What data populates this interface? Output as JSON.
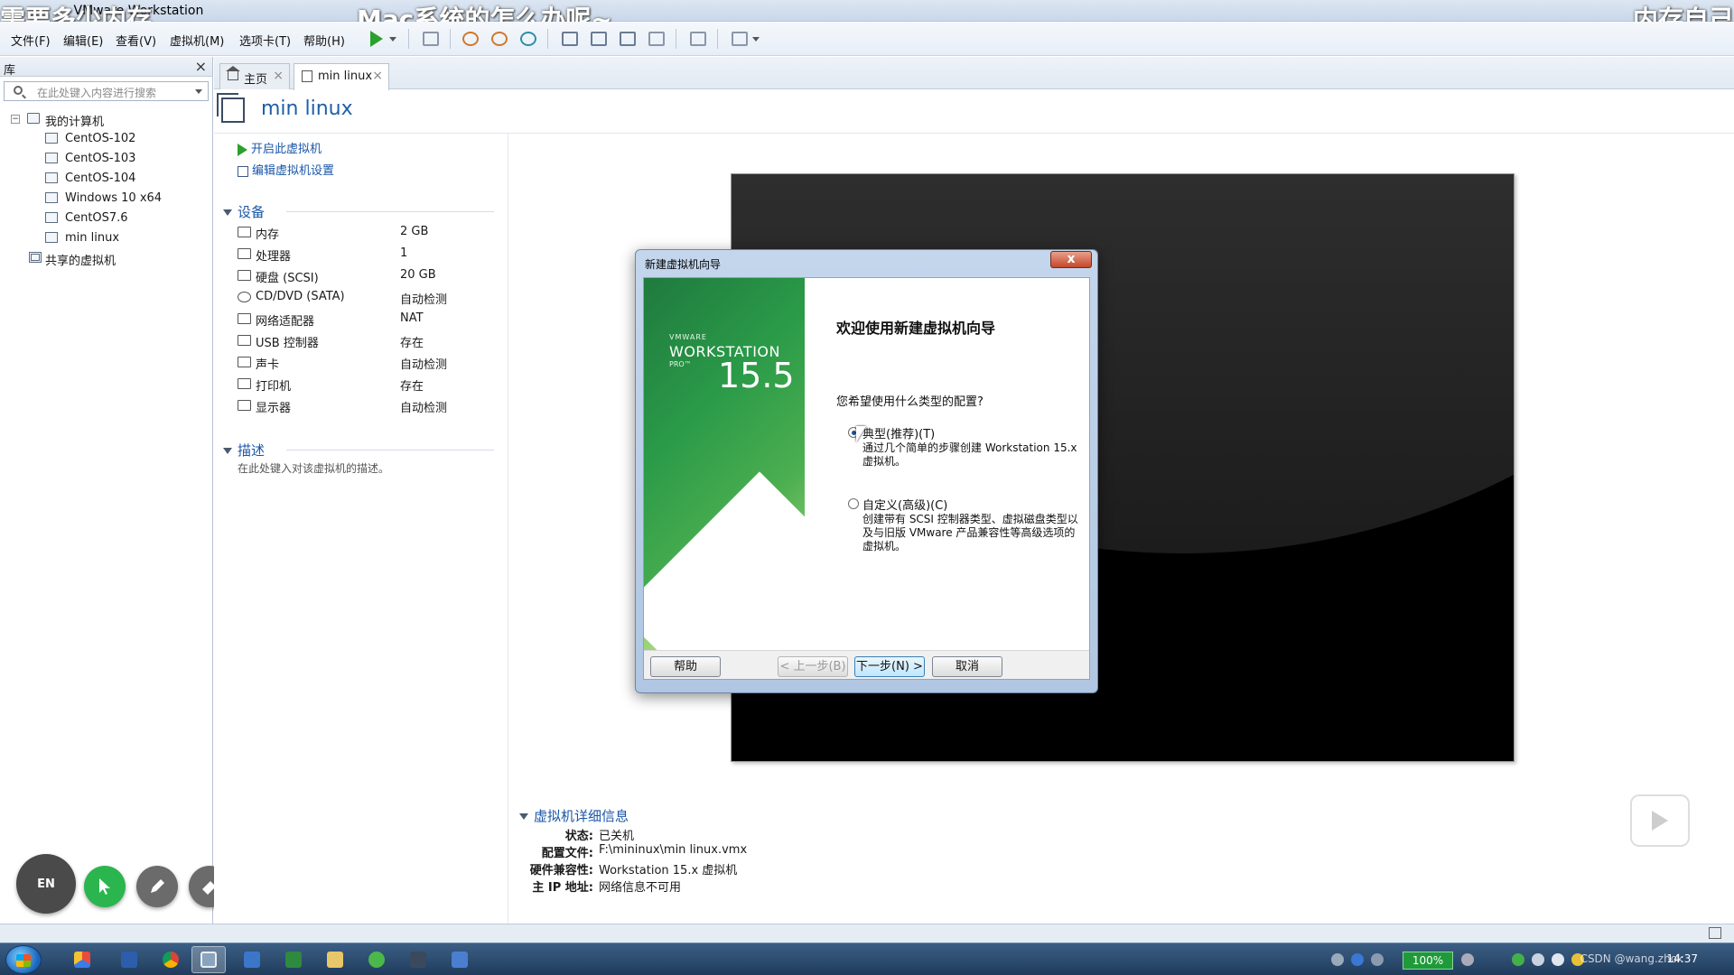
{
  "window": {
    "title": "- VMware Workstation",
    "overlay_left": "需要多少内存",
    "overlay_mid": "Mac系统的怎么办呢~",
    "overlay_right": "内存自己"
  },
  "menu": [
    "文件(F)",
    "编辑(E)",
    "查看(V)",
    "虚拟机(M)",
    "选项卡(T)",
    "帮助(H)"
  ],
  "library": {
    "title": "库",
    "search_placeholder": "在此处键入内容进行搜索",
    "root": "我的计算机",
    "vms": [
      "CentOS-102",
      "CentOS-103",
      "CentOS-104",
      "Windows 10 x64",
      "CentOS7.6",
      "min linux"
    ],
    "shared": "共享的虚拟机"
  },
  "tabs": [
    {
      "label": "主页"
    },
    {
      "label": "min linux"
    }
  ],
  "vm": {
    "name": "min linux",
    "actions": [
      "开启此虚拟机",
      "编辑虚拟机设置"
    ],
    "devices_title": "设备",
    "devices": [
      {
        "name": "内存",
        "value": "2 GB",
        "icon": "memory-icon"
      },
      {
        "name": "处理器",
        "value": "1",
        "icon": "cpu-icon"
      },
      {
        "name": "硬盘 (SCSI)",
        "value": "20 GB",
        "icon": "disk-icon"
      },
      {
        "name": "CD/DVD (SATA)",
        "value": "自动检测",
        "icon": "cd-icon"
      },
      {
        "name": "网络适配器",
        "value": "NAT",
        "icon": "network-icon"
      },
      {
        "name": "USB 控制器",
        "value": "存在",
        "icon": "usb-icon"
      },
      {
        "name": "声卡",
        "value": "自动检测",
        "icon": "sound-icon"
      },
      {
        "name": "打印机",
        "value": "存在",
        "icon": "printer-icon"
      },
      {
        "name": "显示器",
        "value": "自动检测",
        "icon": "display-icon"
      }
    ],
    "desc_title": "描述",
    "desc_placeholder": "在此处键入对该虚拟机的描述。",
    "details_title": "虚拟机详细信息",
    "details": [
      {
        "key": "状态:",
        "value": "已关机"
      },
      {
        "key": "配置文件:",
        "value": "F:\\mininux\\min linux.vmx"
      },
      {
        "key": "硬件兼容性:",
        "value": "Workstation 15.x 虚拟机"
      },
      {
        "key": "主 IP 地址:",
        "value": "网络信息不可用"
      }
    ]
  },
  "dialog": {
    "title": "新建虚拟机向导",
    "close": "x",
    "banner_vmware": "VMWARE",
    "banner_product": "WORKSTATION",
    "banner_pro": "PRO™",
    "banner_version": "15.5",
    "heading": "欢迎使用新建虚拟机向导",
    "question": "您希望使用什么类型的配置?",
    "options": [
      {
        "label": "典型(推荐)(T)",
        "desc": "通过几个简单的步骤创建 Workstation 15.x 虚拟机。",
        "selected": true
      },
      {
        "label": "自定义(高级)(C)",
        "desc": "创建带有 SCSI 控制器类型、虚拟磁盘类型以及与旧版 VMware 产品兼容性等高级选项的虚拟机。",
        "selected": false
      }
    ],
    "buttons": {
      "help": "帮助",
      "back": "< 上一步(B)",
      "next": "下一步(N) >",
      "cancel": "取消"
    }
  },
  "floating_tools": {
    "lang": "EN"
  },
  "taskbar": {
    "battery": "100%",
    "csdn": "CSDN @wang.zhok",
    "clock": "14:37"
  }
}
